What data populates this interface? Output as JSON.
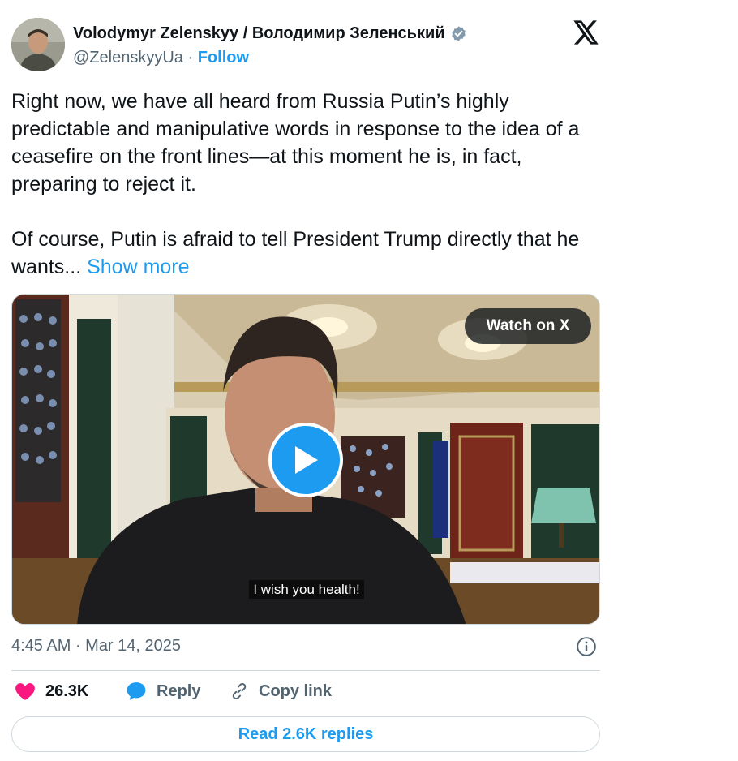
{
  "author": {
    "name": "Volodymyr Zelenskyy / Володимир Зеленський",
    "handle": "@ZelenskyyUa",
    "separator": "·",
    "follow_label": "Follow"
  },
  "tweet": {
    "paragraph1": "Right now, we have all heard from Russia Putin’s highly predictable and manipulative words in response to the idea of a ceasefire on the front lines—at this moment he is, in fact, preparing to reject it.",
    "paragraph2": "Of course, Putin is afraid to tell President Trump directly that he wants... ",
    "show_more_label": "Show more"
  },
  "media": {
    "watch_label": "Watch on X",
    "subtitle": "I wish you health!"
  },
  "meta": {
    "timestamp": "4:45 AM · Mar 14, 2025"
  },
  "actions": {
    "like_count": "26.3K",
    "reply_label": "Reply",
    "copy_link_label": "Copy link"
  },
  "read_replies_label": "Read 2.6K replies",
  "colors": {
    "accent": "#1d9bf0",
    "like": "#f91880",
    "secondary_text": "#536471",
    "border": "#cfd9de"
  },
  "icons": [
    "verified-badge-icon",
    "x-logo-icon",
    "play-icon",
    "info-icon",
    "heart-icon",
    "reply-bubble-icon",
    "link-icon"
  ]
}
